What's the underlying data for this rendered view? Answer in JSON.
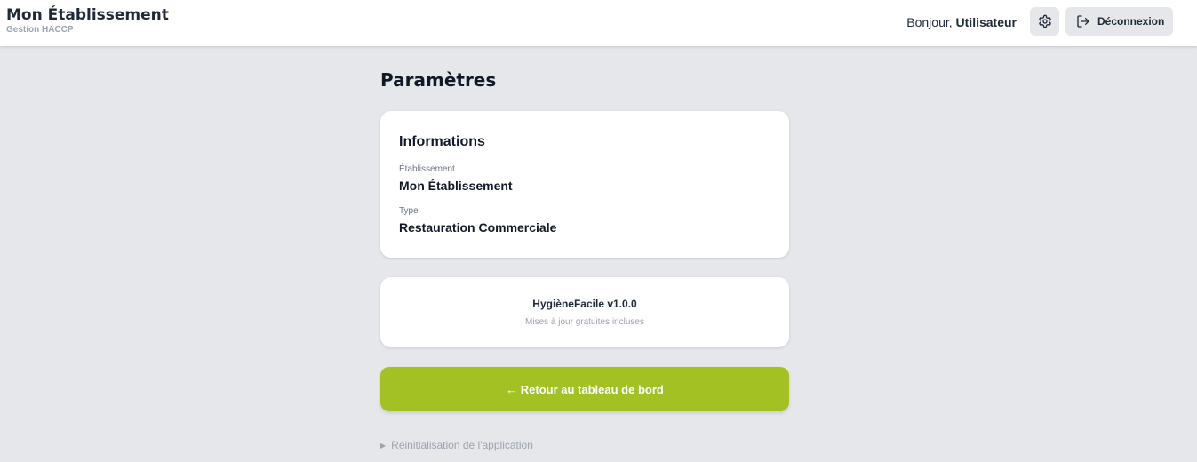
{
  "header": {
    "title": "Mon Établissement",
    "subtitle": "Gestion HACCP",
    "greeting_prefix": "Bonjour,",
    "user_name": "Utilisateur",
    "settings_icon": "gear-icon",
    "logout_icon": "logout-icon",
    "logout_label": "Déconnexion"
  },
  "page": {
    "title": "Paramètres"
  },
  "info_card": {
    "title": "Informations",
    "establishment_label": "Établissement",
    "establishment_value": "Mon Établissement",
    "type_label": "Type",
    "type_value": "Restauration Commerciale"
  },
  "version_card": {
    "name": "HygièneFacile v1.0.0",
    "note": "Mises à jour gratuites incluses"
  },
  "back_button": {
    "label": "← Retour au tableau de bord"
  },
  "reset": {
    "arrow": "▶",
    "label": "Réinitialisation de l'application"
  },
  "colors": {
    "accent": "#a3c123",
    "background": "#e5e7eb",
    "card": "#ffffff"
  }
}
